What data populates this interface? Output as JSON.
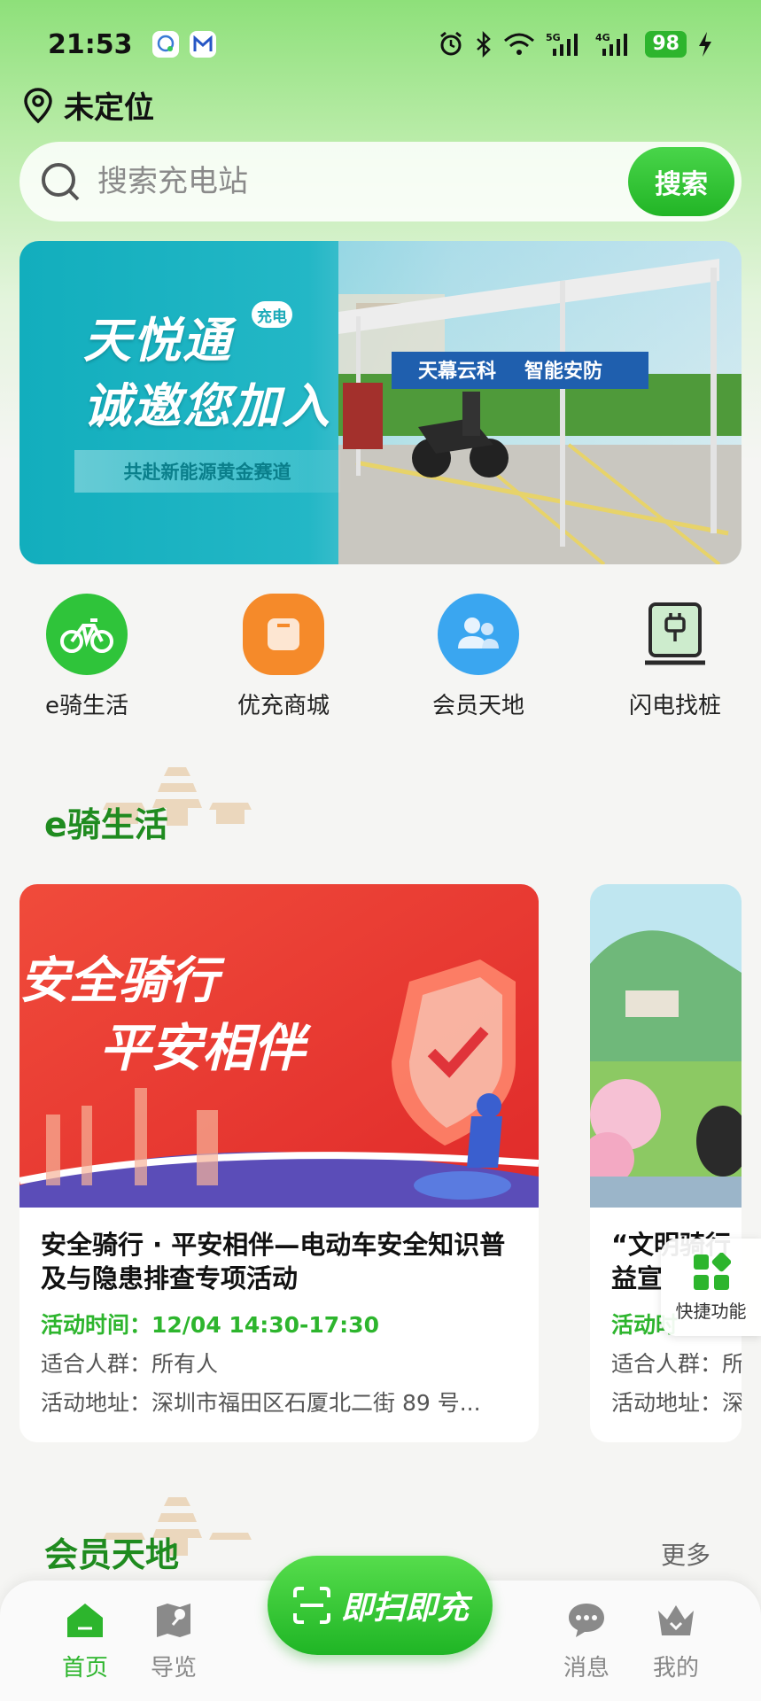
{
  "status_bar": {
    "time": "21:53",
    "notif_icons": [
      "chat-icon",
      "mail-icon"
    ],
    "signal_labels": [
      "5G",
      "4G"
    ],
    "battery": "98"
  },
  "location": {
    "label": "未定位"
  },
  "search": {
    "placeholder": "搜索充电站",
    "button_label": "搜索"
  },
  "banner": {
    "title_line1": "天悦通",
    "badge": "充电",
    "title_line2": "诚邀您加入",
    "tagline": "共赴新能源黄金赛道",
    "sign_text1": "天幕云科",
    "sign_text2": "智能安防"
  },
  "quick_nav": [
    {
      "label": "e骑生活",
      "icon": "bicycle-icon",
      "color": "#2fc43a"
    },
    {
      "label": "优充商城",
      "icon": "shopping-bag-icon",
      "color": "#f58a2a"
    },
    {
      "label": "会员天地",
      "icon": "members-icon",
      "color": "#3aa6f0"
    },
    {
      "label": "闪电找桩",
      "icon": "charging-pile-icon",
      "color": "#2a2a2a"
    }
  ],
  "section_eride": {
    "title": "e骑生活"
  },
  "activities": [
    {
      "image_text1": "安全骑行",
      "image_text2": "平安相伴",
      "title": "安全骑行 · 平安相伴—电动车安全知识普及与隐患排查专项活动",
      "time_label": "活动时间：",
      "time_value": "12/04 14:30-17:30",
      "crowd": "适合人群：所有人",
      "address": "活动地址：深圳市福田区石厦北二街 89 号..."
    },
    {
      "title": "“文明骑行 益宣",
      "time_label": "活动时",
      "crowd": "适合人群：所",
      "address": "活动地址：深"
    }
  ],
  "quick_fn": {
    "label": "快捷功能"
  },
  "section_members": {
    "title": "会员天地",
    "more": "更多"
  },
  "tab_bar": {
    "home": "首页",
    "guide": "导览",
    "scan": "即扫即充",
    "messages": "消息",
    "mine": "我的"
  },
  "colors": {
    "brand_green": "#2db52d",
    "accent_orange": "#f58a2a",
    "accent_blue": "#3aa6f0"
  }
}
